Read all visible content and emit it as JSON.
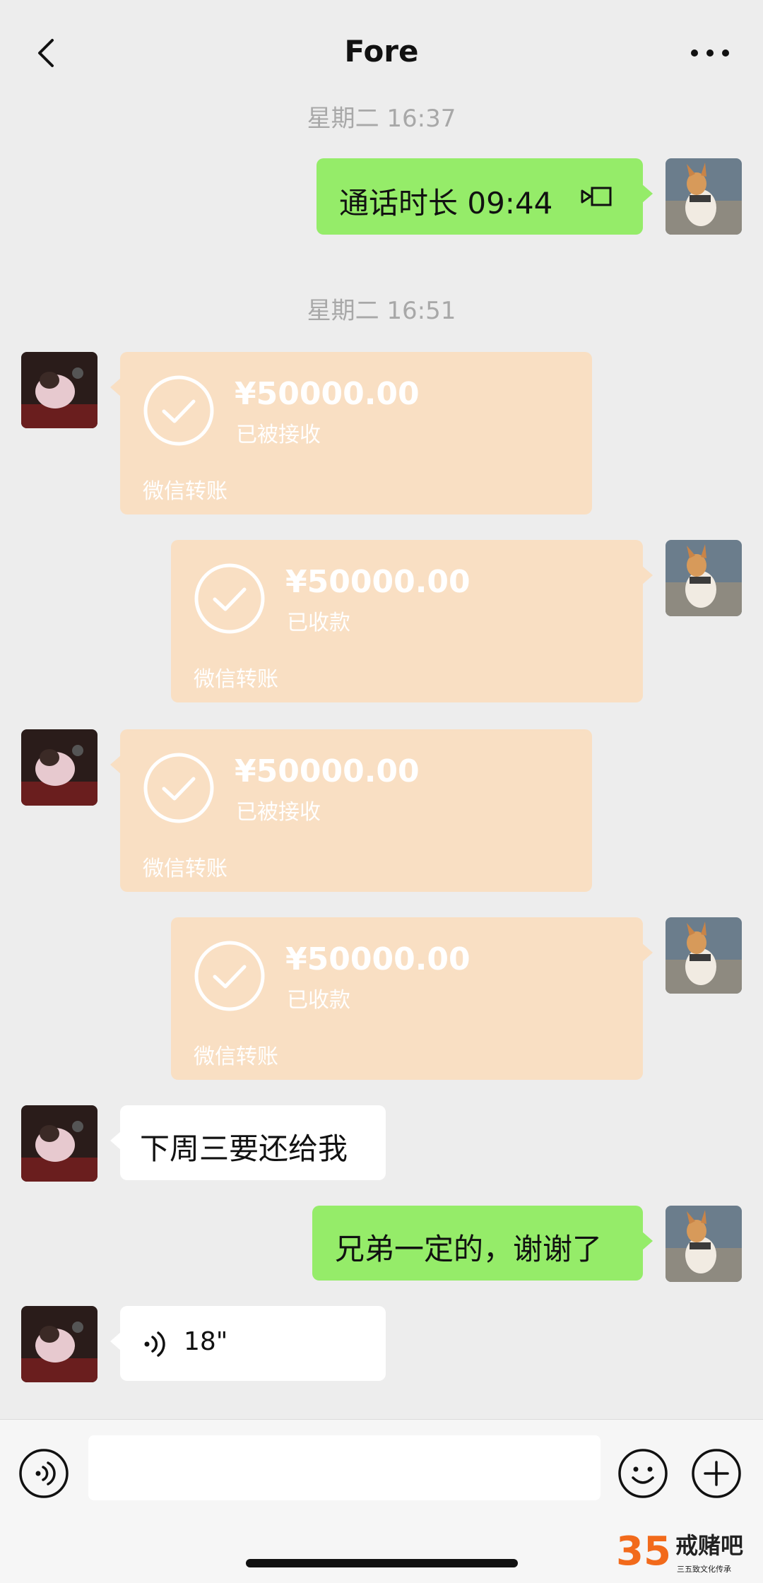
{
  "header": {
    "title": "Fore"
  },
  "timestamps": [
    "星期二 16:37",
    "星期二 16:51"
  ],
  "messages": {
    "call": {
      "text": "通话时长 09:44"
    },
    "transfers": [
      {
        "amount": "¥50000.00",
        "status": "已被接收",
        "label": "微信转账"
      },
      {
        "amount": "¥50000.00",
        "status": "已收款",
        "label": "微信转账"
      },
      {
        "amount": "¥50000.00",
        "status": "已被接收",
        "label": "微信转账"
      },
      {
        "amount": "¥50000.00",
        "status": "已收款",
        "label": "微信转账"
      }
    ],
    "text1": "下周三要还给我",
    "text2": "兄弟一定的，谢谢了",
    "voice": {
      "duration": "18\""
    }
  },
  "input": {
    "placeholder": ""
  },
  "watermark": {
    "logo": "35",
    "name": "戒赌吧",
    "sub": "三五致文化传承"
  },
  "colors": {
    "background": "#ededed",
    "sent_bubble": "#95ec69",
    "received_bubble": "#ffffff",
    "transfer_bubble": "#f9dfc3",
    "timestamp": "#a8a8a8"
  }
}
